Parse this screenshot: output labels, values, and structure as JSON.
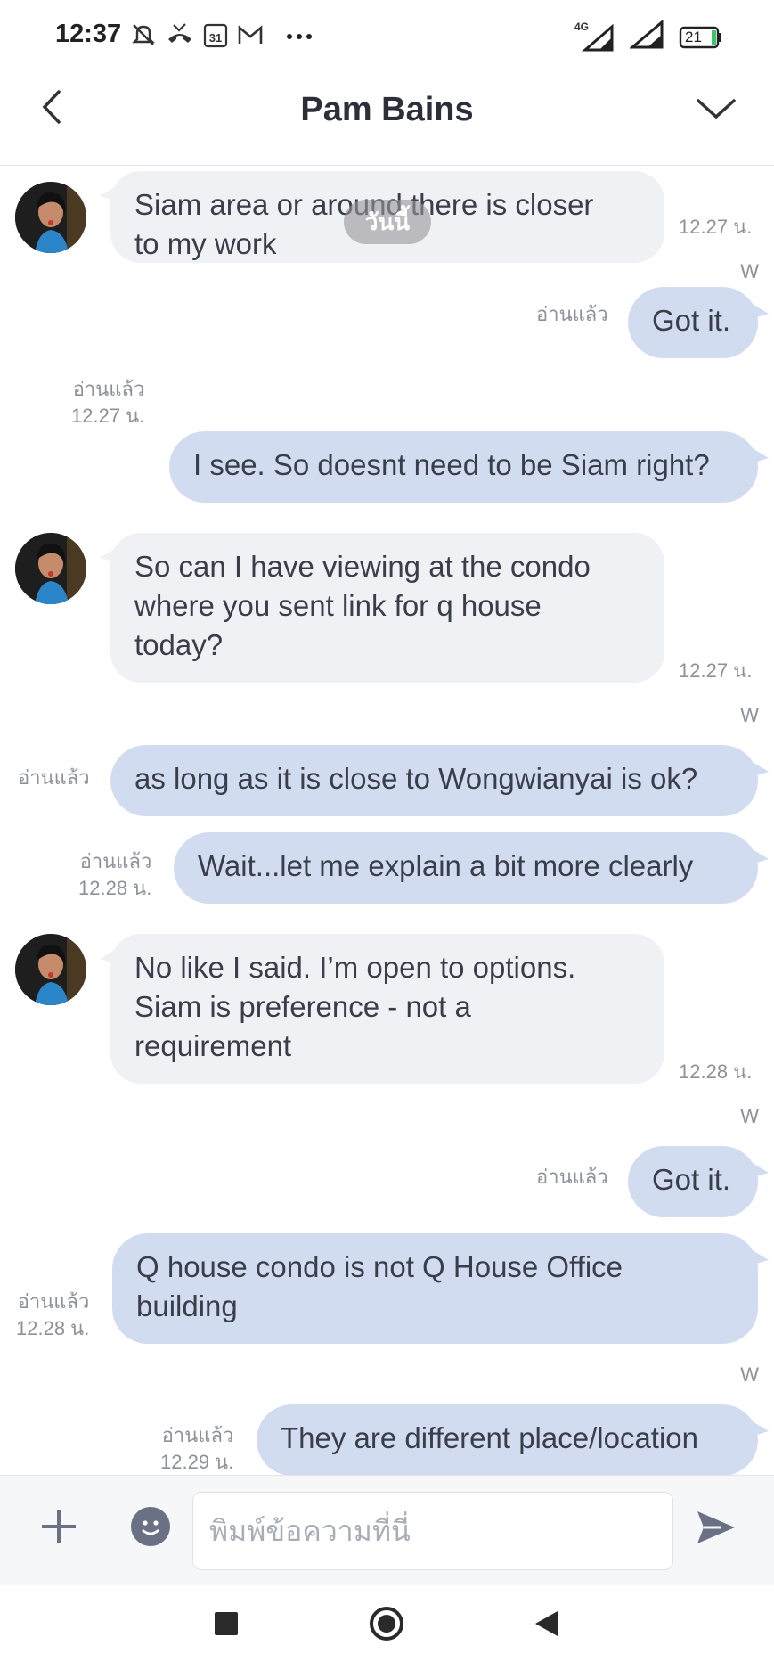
{
  "status_bar": {
    "time": "12:37",
    "icons_left": [
      "silent-icon",
      "missed-call-icon",
      "calendar-icon",
      "gmail-icon",
      "more-dots-icon"
    ],
    "calendar_day": "31",
    "network": "4G",
    "battery": "21"
  },
  "header": {
    "title": "Pam Bains"
  },
  "chat": {
    "date_label": "วันนี้",
    "messages": [
      {
        "from": "in",
        "lines": [
          "Siam area or around there is closer",
          "to my work"
        ],
        "time": "12.27 น."
      },
      {
        "from": "out",
        "lines": [
          "Got it."
        ],
        "read": "อ่านแล้ว",
        "time": "",
        "sender_mark": "W"
      },
      {
        "from": "out",
        "lines": [
          "I see. So doesnt need to be Siam right?"
        ],
        "read": "อ่านแล้ว",
        "time": "12.27 น."
      },
      {
        "from": "in",
        "lines": [
          "So can I have viewing at the condo",
          "where you sent link for q house",
          "today?"
        ],
        "time": "12.27 น."
      },
      {
        "from": "out",
        "lines": [
          "as long as it is close to Wongwianyai is ok?"
        ],
        "read": "อ่านแล้ว",
        "time": "",
        "sender_mark": "W"
      },
      {
        "from": "out",
        "lines": [
          "Wait...let me explain a bit more clearly"
        ],
        "read": "อ่านแล้ว",
        "time": "12.28 น."
      },
      {
        "from": "in",
        "lines": [
          "No like I said. I’m open to options.",
          "Siam is preference - not a",
          "requirement"
        ],
        "time": "12.28 น."
      },
      {
        "from": "out",
        "lines": [
          "Got it."
        ],
        "read": "อ่านแล้ว",
        "time": "",
        "sender_mark": "W"
      },
      {
        "from": "out",
        "lines": [
          "Q house condo is not Q House Office",
          "building"
        ],
        "read": "อ่านแล้ว",
        "time": "12.28 น."
      },
      {
        "from": "out",
        "lines": [
          "They are different place/location"
        ],
        "read": "อ่านแล้ว",
        "time": "12.29 น.",
        "sender_mark": "W"
      }
    ]
  },
  "input_bar": {
    "placeholder": "พิมพ์ข้อความที่นี่"
  },
  "colors": {
    "incoming_bubble": "#eff1f4",
    "outgoing_bubble": "#d2dcf1",
    "meta_text": "#8d919a",
    "send_icon": "#6b7184"
  }
}
